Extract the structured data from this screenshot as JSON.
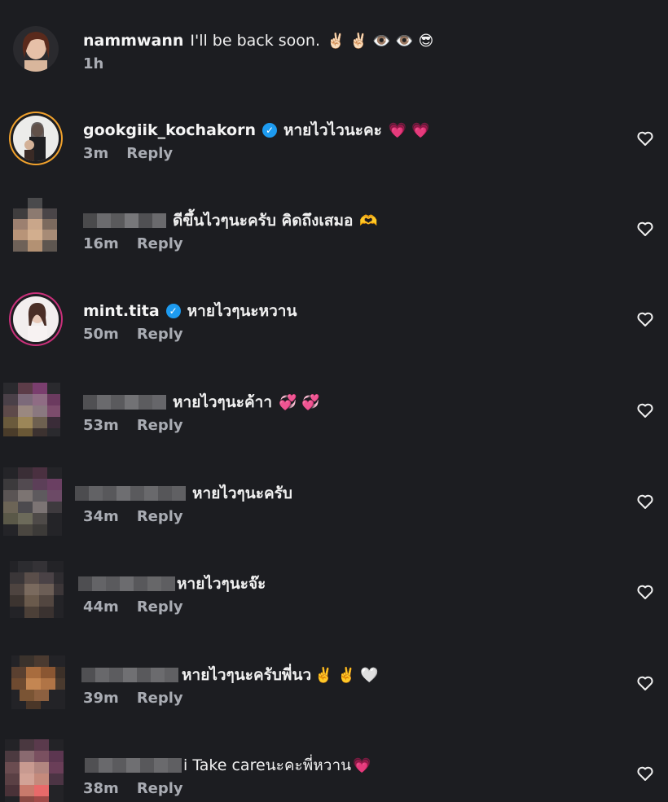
{
  "post": {
    "username": "nammwann",
    "text": "I'll be back soon.",
    "emojis": "✌🏻 ✌🏻 👁️ 👁️ 😎",
    "time": "1h"
  },
  "comments": [
    {
      "username": "gookgiik_kochakorn",
      "verified": true,
      "text": "หายไวไวนะคะ",
      "emojis": "💗 💗",
      "time": "3m",
      "reply": "Reply"
    },
    {
      "username": "",
      "verified": false,
      "text": "ดีขึ้นไวๆนะครับ คิดถึงเสมอ",
      "emojis": "🫶",
      "time": "16m",
      "reply": "Reply"
    },
    {
      "username": "mint.tita",
      "verified": true,
      "text": "หายไวๆนะหวาน",
      "emojis": "",
      "time": "50m",
      "reply": "Reply"
    },
    {
      "username": "",
      "verified": false,
      "text": "หายไวๆนะค้าา",
      "emojis": "💞 💞",
      "time": "53m",
      "reply": "Reply"
    },
    {
      "username": "",
      "verified": false,
      "text": "หายไวๆนะครับ",
      "emojis": "",
      "time": "34m",
      "reply": "Reply"
    },
    {
      "username": "",
      "verified": false,
      "text": "หายไวๆนะจ๊ะ",
      "emojis": "",
      "time": "44m",
      "reply": "Reply"
    },
    {
      "username": "",
      "verified": false,
      "text": "หายไวๆนะครับพี่นว",
      "emojis": "✌️ ✌️ 🤍",
      "time": "39m",
      "reply": "Reply"
    },
    {
      "username": "",
      "verified": false,
      "text": "i Take careนะคะพี่หวาน",
      "emojis": "💗",
      "time": "38m",
      "reply": "Reply"
    }
  ],
  "colors": {
    "background": "#1c1d21",
    "meta": "#a9acb3",
    "verified": "#1d9bf0"
  }
}
